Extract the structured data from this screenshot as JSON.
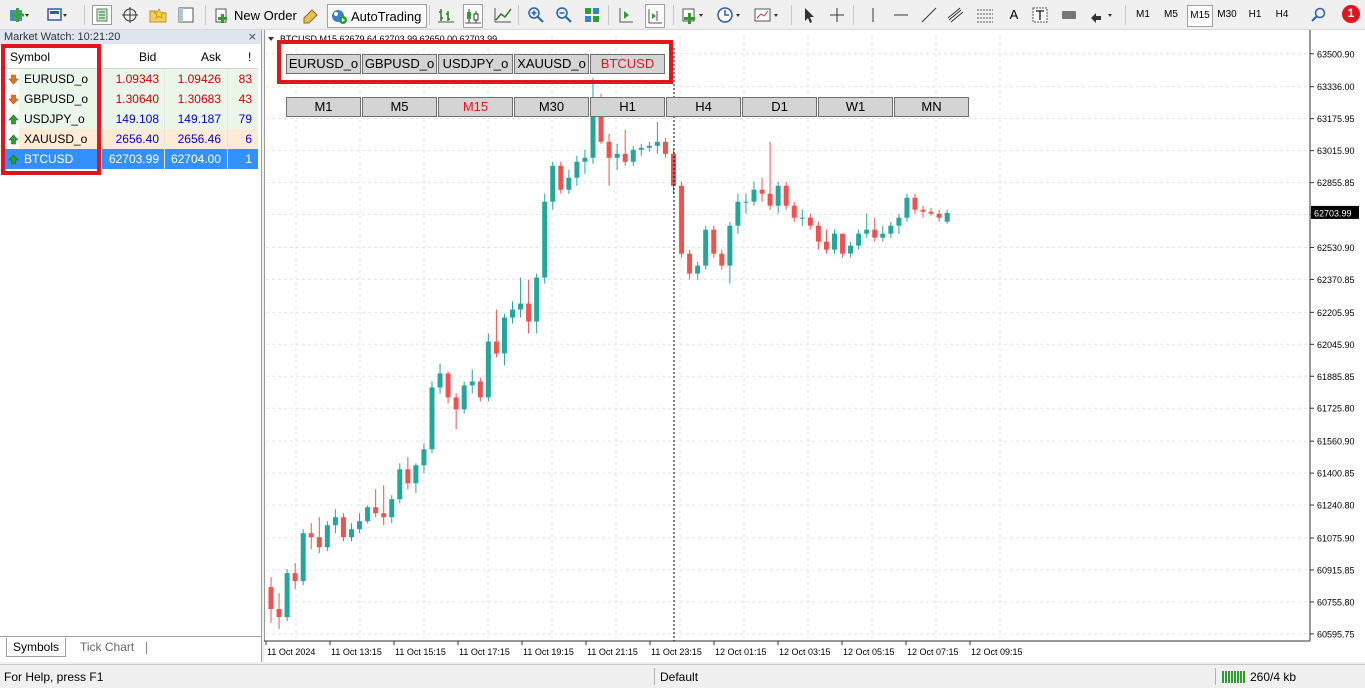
{
  "toolbar": {
    "new_order": "New Order",
    "autotrading": "AutoTrading",
    "timeframes": [
      "M1",
      "M5",
      "M15",
      "M30",
      "H1",
      "H4"
    ],
    "selected_timeframe": "M15",
    "notification_count": "1"
  },
  "market_watch": {
    "title": "Market Watch: 10:21:20",
    "close": "×",
    "columns": {
      "symbol": "Symbol",
      "bid": "Bid",
      "ask": "Ask",
      "spread": "!"
    },
    "rows": [
      {
        "symbol": "EURUSD_o",
        "bid": "1.09343",
        "ask": "1.09426",
        "spread": "83",
        "color": "#cc0000",
        "bg": "#fff",
        "arrow": "down"
      },
      {
        "symbol": "GBPUSD_o",
        "bid": "1.30640",
        "ask": "1.30683",
        "spread": "43",
        "color": "#cc0000",
        "bg": "#fff",
        "arrow": "down"
      },
      {
        "symbol": "USDJPY_o",
        "bid": "149.108",
        "ask": "149.187",
        "spread": "79",
        "color": "#0000cc",
        "bg": "#eaf6ea",
        "arrow": "up"
      },
      {
        "symbol": "XAUUSD_o",
        "bid": "2656.40",
        "ask": "2656.46",
        "spread": "6",
        "color": "#0000cc",
        "bg": "#fdebd6",
        "arrow": "up"
      },
      {
        "symbol": "BTCUSD",
        "bid": "62703.99",
        "ask": "62704.00",
        "spread": "1",
        "color": "#ffffff",
        "bg": "#3390ff",
        "arrow": "up"
      }
    ],
    "tabs": [
      "Symbols",
      "Tick Chart"
    ]
  },
  "chart": {
    "header": "BTCUSD,M15  62679.64 62703.99 62650.00 62703.99",
    "symbol_buttons": [
      "EURUSD_o",
      "GBPUSD_o",
      "USDJPY_o",
      "XAUUSD_o",
      "BTCUSD"
    ],
    "active_symbol": "BTCUSD",
    "timeframe_buttons": [
      "M1",
      "M5",
      "M15",
      "M30",
      "H1",
      "H4",
      "D1",
      "W1",
      "MN"
    ],
    "active_timeframe": "M15",
    "current_price_label": "62703.99",
    "bull_color": "#26a69a",
    "bear_color": "#ef5350"
  },
  "chart_data": {
    "type": "candlestick",
    "symbol": "BTCUSD",
    "timeframe": "M15",
    "y_ticks": [
      63500.9,
      63336.0,
      63175.95,
      63015.9,
      62855.85,
      62695.8,
      62530.9,
      62370.85,
      62205.95,
      62045.9,
      61885.85,
      61725.8,
      61560.9,
      61400.85,
      61240.8,
      61075.9,
      60915.85,
      60755.8,
      60595.75
    ],
    "x_ticks": [
      "11 Oct 2024",
      "11 Oct 13:15",
      "11 Oct 15:15",
      "11 Oct 17:15",
      "11 Oct 19:15",
      "11 Oct 21:15",
      "11 Oct 23:15",
      "12 Oct 01:15",
      "12 Oct 03:15",
      "12 Oct 05:15",
      "12 Oct 07:15",
      "12 Oct 09:15"
    ],
    "ylim": [
      60560,
      63590
    ],
    "ohlc": [
      [
        60830,
        60880,
        60650,
        60720
      ],
      [
        60720,
        60800,
        60620,
        60680
      ],
      [
        60680,
        60920,
        60660,
        60900
      ],
      [
        60900,
        60950,
        60820,
        60860
      ],
      [
        60860,
        61120,
        60840,
        61100
      ],
      [
        61100,
        61150,
        61020,
        61080
      ],
      [
        61080,
        61180,
        61000,
        61030
      ],
      [
        61030,
        61160,
        61010,
        61140
      ],
      [
        61140,
        61220,
        61100,
        61180
      ],
      [
        61180,
        61200,
        61060,
        61080
      ],
      [
        61080,
        61150,
        61060,
        61120
      ],
      [
        61120,
        61200,
        61100,
        61160
      ],
      [
        61160,
        61240,
        61150,
        61230
      ],
      [
        61230,
        61320,
        61180,
        61200
      ],
      [
        61200,
        61340,
        61140,
        61180
      ],
      [
        61180,
        61290,
        61150,
        61270
      ],
      [
        61270,
        61450,
        61250,
        61420
      ],
      [
        61420,
        61480,
        61320,
        61350
      ],
      [
        61350,
        61450,
        61300,
        61440
      ],
      [
        61440,
        61550,
        61400,
        61520
      ],
      [
        61520,
        61860,
        61500,
        61830
      ],
      [
        61830,
        61950,
        61800,
        61900
      ],
      [
        61900,
        61910,
        61750,
        61780
      ],
      [
        61780,
        61800,
        61620,
        61720
      ],
      [
        61720,
        61860,
        61700,
        61840
      ],
      [
        61840,
        61920,
        61800,
        61860
      ],
      [
        61860,
        61880,
        61760,
        61780
      ],
      [
        61780,
        62100,
        61760,
        62060
      ],
      [
        62060,
        62220,
        61980,
        62000
      ],
      [
        62000,
        62200,
        61940,
        62180
      ],
      [
        62180,
        62260,
        62150,
        62220
      ],
      [
        62220,
        62380,
        62180,
        62250
      ],
      [
        62250,
        62370,
        62100,
        62160
      ],
      [
        62160,
        62400,
        62100,
        62380
      ],
      [
        62380,
        62800,
        62350,
        62760
      ],
      [
        62760,
        62960,
        62720,
        62940
      ],
      [
        62940,
        62960,
        62800,
        62820
      ],
      [
        62820,
        62920,
        62800,
        62880
      ],
      [
        62880,
        62990,
        62840,
        62960
      ],
      [
        62960,
        63020,
        62900,
        62980
      ],
      [
        62980,
        63380,
        62950,
        63260
      ],
      [
        63260,
        63300,
        63050,
        63060
      ],
      [
        63060,
        63100,
        62840,
        62980
      ],
      [
        62980,
        63050,
        62920,
        63000
      ],
      [
        63000,
        63120,
        62940,
        62960
      ],
      [
        62960,
        63040,
        62940,
        63020
      ],
      [
        63020,
        63050,
        62990,
        63030
      ],
      [
        63030,
        63060,
        63010,
        63040
      ],
      [
        63040,
        63160,
        63000,
        63060
      ],
      [
        63060,
        63080,
        62980,
        63000
      ],
      [
        63000,
        63020,
        62800,
        62840
      ],
      [
        62840,
        62860,
        62480,
        62500
      ],
      [
        62500,
        62520,
        62370,
        62400
      ],
      [
        62400,
        62460,
        62370,
        62440
      ],
      [
        62440,
        62640,
        62420,
        62620
      ],
      [
        62620,
        62640,
        62480,
        62500
      ],
      [
        62500,
        62520,
        62420,
        62440
      ],
      [
        62440,
        62660,
        62350,
        62640
      ],
      [
        62640,
        62800,
        62600,
        62760
      ],
      [
        62760,
        62800,
        62700,
        62760
      ],
      [
        62760,
        62860,
        62740,
        62820
      ],
      [
        62820,
        62880,
        62760,
        62800
      ],
      [
        62800,
        63060,
        62720,
        62740
      ],
      [
        62740,
        62860,
        62700,
        62840
      ],
      [
        62840,
        62860,
        62720,
        62740
      ],
      [
        62740,
        62760,
        62660,
        62680
      ],
      [
        62680,
        62720,
        62640,
        62680
      ],
      [
        62680,
        62700,
        62620,
        62640
      ],
      [
        62640,
        62660,
        62520,
        62560
      ],
      [
        62560,
        62620,
        62500,
        62520
      ],
      [
        62520,
        62620,
        62500,
        62600
      ],
      [
        62600,
        62600,
        62480,
        62500
      ],
      [
        62500,
        62560,
        62480,
        62540
      ],
      [
        62540,
        62620,
        62520,
        62600
      ],
      [
        62600,
        62700,
        62580,
        62620
      ],
      [
        62620,
        62680,
        62560,
        62580
      ],
      [
        62580,
        62640,
        62560,
        62600
      ],
      [
        62600,
        62660,
        62580,
        62640
      ],
      [
        62640,
        62700,
        62600,
        62680
      ],
      [
        62680,
        62800,
        62660,
        62780
      ],
      [
        62780,
        62800,
        62700,
        62720
      ],
      [
        62720,
        62740,
        62680,
        62710
      ],
      [
        62710,
        62730,
        62690,
        62700
      ],
      [
        62700,
        62720,
        62660,
        62680
      ],
      [
        62660,
        62720,
        62650,
        62704
      ]
    ],
    "crosshair_x_label": "11 Oct 23:15"
  }
}
